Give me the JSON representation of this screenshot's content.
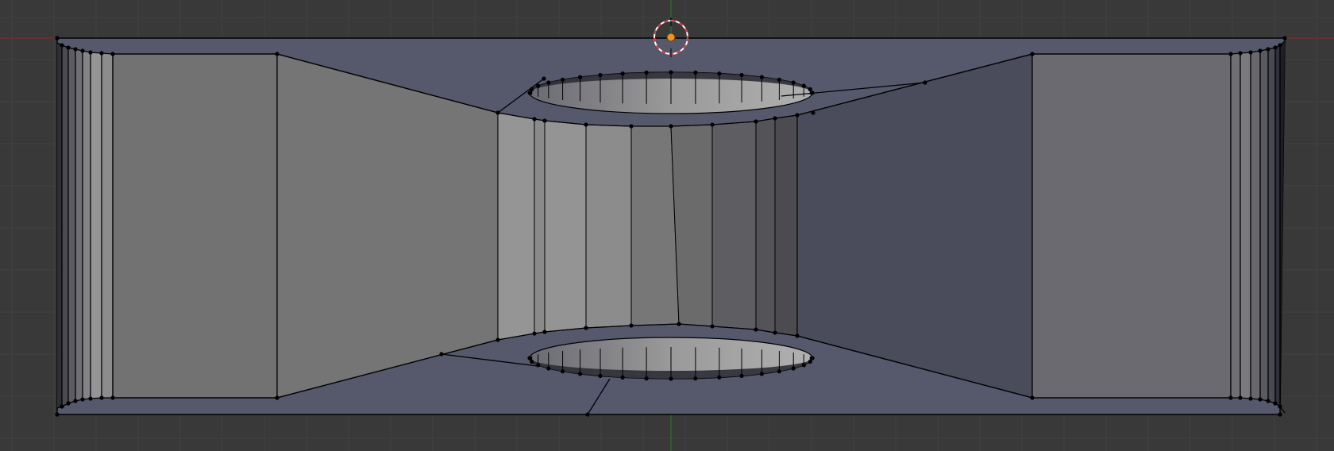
{
  "viewport": {
    "view": "front-orthographic",
    "mode": "edit-mode",
    "display": "solid-with-wireframe"
  },
  "colors": {
    "background": "#393939",
    "grid_line": "#414141",
    "x_axis": "#8a2a2a",
    "z_axis": "#2a7a2a",
    "wire": "#000000",
    "vertex": "#000000",
    "cursor_ring_red": "#d43a3a",
    "cursor_ring_white": "#ffffff",
    "origin_dot": "#e8962c"
  },
  "scene": {
    "object": "mesh-object",
    "cursor": "3d-cursor",
    "origin": "object-origin"
  }
}
